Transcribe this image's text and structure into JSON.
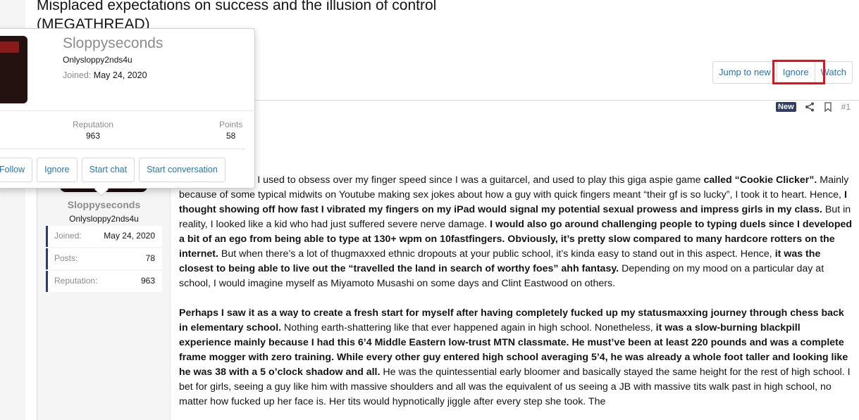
{
  "thread": {
    "title": "Misplaced expectations on success and the illusion of control (MEGATHREAD)"
  },
  "thread_actions": {
    "jump_to_new": "Jump to new",
    "ignore": "Ignore",
    "watch": "Watch"
  },
  "post": {
    "badge": "New",
    "number": "#1",
    "author": {
      "name": "Sloppyseconds",
      "user_title": "Onlysloppy2nds4u",
      "stats": [
        {
          "label": "Joined:",
          "value": "May 24, 2020"
        },
        {
          "label": "Posts:",
          "value": "78"
        },
        {
          "label": "Reputation:",
          "value": "963"
        }
      ]
    }
  },
  "member_card": {
    "name": "Sloppyseconds",
    "user_title": "Onlysloppy2nds4u",
    "joined_label": "Joined:",
    "joined_value": "May 24, 2020",
    "reputation_label": "Reputation",
    "reputation_value": "963",
    "points_label": "Points",
    "points_value": "58",
    "actions": {
      "follow": "Follow",
      "ignore": "Ignore",
      "start_chat": "Start chat",
      "start_conversation": "Start conversation"
    }
  },
  "icons": {
    "share": "share-icon",
    "bookmark": "bookmark-icon"
  },
  "colors": {
    "link": "#2577b1",
    "highlight": "#e0141e",
    "badge_bg": "#2f3e62"
  }
}
